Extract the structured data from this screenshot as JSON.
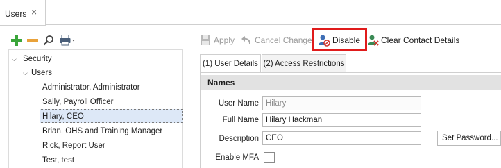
{
  "document_tab": {
    "label": "Users",
    "close": "×"
  },
  "tree": {
    "root": "Security",
    "group": "Users",
    "items": [
      "Administrator, Administrator",
      "Sally, Payroll Officer",
      "Hilary, CEO",
      "Brian, OHS and Training Manager",
      "Rick, Report User",
      "Test, test"
    ],
    "selected_index": 2
  },
  "toolbar": {
    "apply": "Apply",
    "cancel_changes": "Cancel Changes",
    "disable": "Disable",
    "clear_contact_details": "Clear Contact Details"
  },
  "tabs": [
    {
      "label": "(1) User Details",
      "active": true
    },
    {
      "label": "(2) Access Restrictions",
      "active": false
    }
  ],
  "section": {
    "title": "Names"
  },
  "fields": {
    "user_name": {
      "label": "User Name",
      "value": "Hilary"
    },
    "full_name": {
      "label": "Full Name",
      "value": "Hilary Hackman"
    },
    "description": {
      "label": "Description",
      "value": "CEO"
    },
    "enable_mfa": {
      "label": "Enable MFA",
      "checked": false
    }
  },
  "set_password": {
    "label": "Set Password..."
  },
  "colors": {
    "highlight_border": "#e01b1b",
    "selected_row": "#dde8f7",
    "add_green": "#3aa53a",
    "remove_orange": "#e9a23a",
    "header_gray": "#e2e2e2"
  }
}
